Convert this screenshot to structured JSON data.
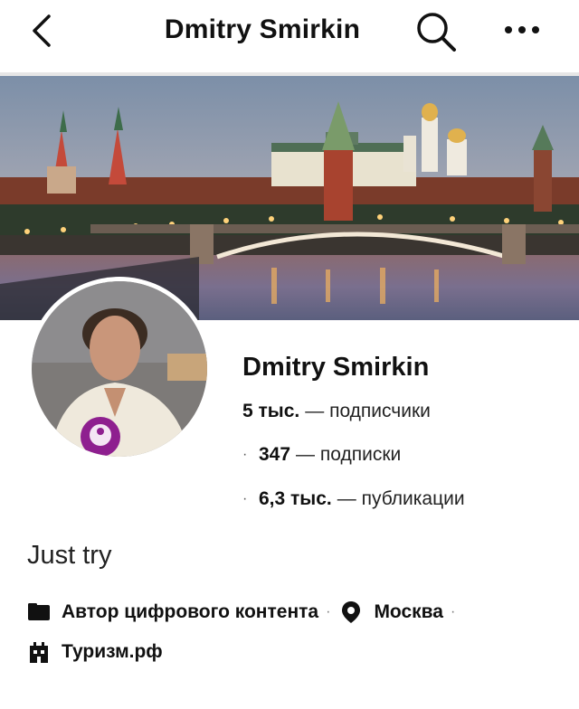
{
  "header": {
    "title": "Dmitry Smirkin",
    "back_icon": "chevron-left-icon",
    "search_icon": "search-icon",
    "more_icon": "more-horizontal-icon"
  },
  "profile": {
    "name": "Dmitry Smirkin",
    "stats": [
      {
        "value": "5 тыс.",
        "label": "— подписчики"
      },
      {
        "value": "347",
        "label": "— подписки"
      },
      {
        "value": "6,3 тыс.",
        "label": "— публикации"
      }
    ],
    "bio": "Just try",
    "meta": {
      "category": "Автор цифрового контента",
      "location": "Москва",
      "link": "Туризм.рф",
      "separator": "·"
    }
  },
  "colors": {
    "badge": "#8e1f8f",
    "divider": "#e6e6e6"
  }
}
